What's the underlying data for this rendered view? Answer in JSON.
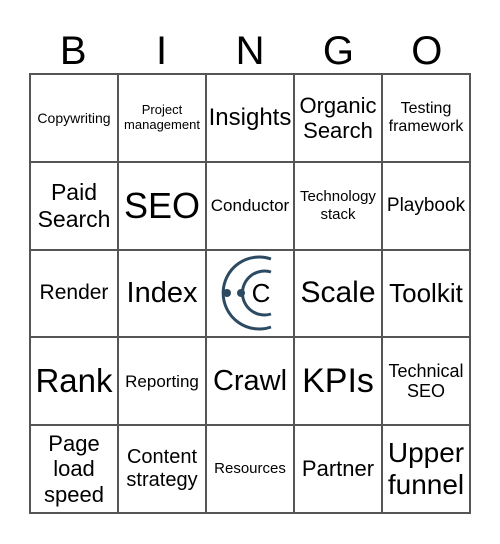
{
  "header": [
    "B",
    "I",
    "N",
    "G",
    "O"
  ],
  "cells": [
    {
      "text": "Copywriting",
      "size": 14
    },
    {
      "text": "Project management",
      "size": 13
    },
    {
      "text": "Insights",
      "size": 24
    },
    {
      "text": "Organic Search",
      "size": 22
    },
    {
      "text": "Testing framework",
      "size": 16
    },
    {
      "text": "Paid Search",
      "size": 23
    },
    {
      "text": "SEO",
      "size": 36
    },
    {
      "text": "Conductor",
      "size": 17
    },
    {
      "text": "Technology stack",
      "size": 15
    },
    {
      "text": "Playbook",
      "size": 19
    },
    {
      "text": "Render",
      "size": 21
    },
    {
      "text": "Index",
      "size": 29
    },
    {
      "text": "",
      "free": true,
      "icon": "conductor-logo-icon"
    },
    {
      "text": "Scale",
      "size": 30
    },
    {
      "text": "Toolkit",
      "size": 26
    },
    {
      "text": "Rank",
      "size": 33
    },
    {
      "text": "Reporting",
      "size": 17
    },
    {
      "text": "Crawl",
      "size": 29
    },
    {
      "text": "KPIs",
      "size": 34
    },
    {
      "text": "Technical SEO",
      "size": 18
    },
    {
      "text": "Page load speed",
      "size": 22
    },
    {
      "text": "Content strategy",
      "size": 20
    },
    {
      "text": "Resources",
      "size": 15
    },
    {
      "text": "Partner",
      "size": 22
    },
    {
      "text": "Upper funnel",
      "size": 28
    }
  ],
  "logo": {
    "letter": "C",
    "arc_color": "#2d4a63"
  }
}
